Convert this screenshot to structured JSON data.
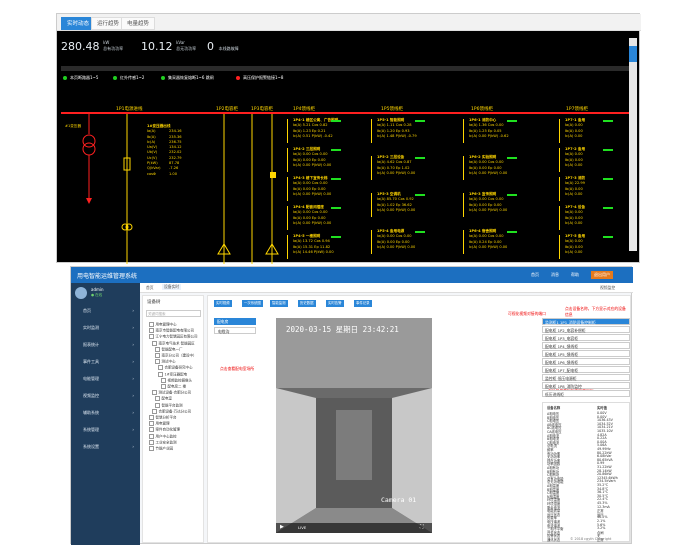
{
  "tabs": [
    "实时动态",
    "运行趋势",
    "电量趋势"
  ],
  "kpis": [
    {
      "value": "280.48",
      "unit": "kW",
      "label": "总有功功率"
    },
    {
      "value": "10.12",
      "unit": "kVar",
      "label": "总无功功率"
    },
    {
      "value": "0",
      "unit": "",
      "label": "本线路故障"
    }
  ],
  "legend": [
    {
      "text": "本页断路器1~5",
      "color": "#20d020"
    },
    {
      "text": "红外传感1~2",
      "color": "#20d020"
    },
    {
      "text": "集采器恢复熔断1~6 跳闸",
      "color": "#20d020"
    },
    {
      "text": "高压保护报警链接1~8",
      "color": "#ff2020"
    }
  ],
  "busbars": [
    "1P1电源进线",
    "1P2电容柜",
    "1P3电容柜",
    "1P4馈线柜",
    "1P5馈线柜",
    "1P6馈线柜",
    "1P7馈线柜"
  ],
  "transformer": "#1变压器",
  "incoming": {
    "title": "1#变压器出线",
    "rows": [
      [
        "Ia(A)",
        "234.16"
      ],
      [
        "Ib(A)",
        "235.36"
      ],
      [
        "Ic(A)",
        "236.75"
      ],
      [
        "Ua(V)",
        "134.12"
      ],
      [
        "Ub(V)",
        "232.02"
      ],
      [
        "Uc(V)",
        "232.79"
      ],
      [
        "P(kW)",
        "87.78"
      ],
      [
        "Q(kVar)",
        "-7.26"
      ],
      [
        "cosΦ",
        "1.00"
      ]
    ]
  },
  "feeders": [
    {
      "title": "1P4-1 楼区公寓、广告照明",
      "rows": [
        "Ia(A) 5.21 Cos 0.82",
        "Ib(A) 1.23 Ep 0.21",
        "Ic(A) 0.51 P(kW) -0.42"
      ]
    },
    {
      "title": "1P4-2 三层照明",
      "rows": [
        "Ia(A) 0.00 Cos 0.00",
        "Ib(A) 0.00 Ep 0.00",
        "Ic(A) 0.00 P(kW) 0.00"
      ]
    },
    {
      "title": "1P4-3 楼下宣传长梯",
      "rows": [
        "Ia(A) 0.00 Cos 0.00",
        "Ib(A) 0.00 Ep 0.00",
        "Ic(A) 0.00 P(kW) 0.00"
      ]
    },
    {
      "title": "1P4-4 配套间插座",
      "rows": [
        "Ia(A) 0.00 Cos 0.00",
        "Ib(A) 0.00 Ep 0.00",
        "Ic(A) 0.00 P(kW) 0.00"
      ]
    },
    {
      "title": "1P4-5 一楼照明",
      "rows": [
        "Ia(A) 13.72 Cos 0.94",
        "Ib(A) 15.31 Ep 11.82",
        "Ic(A) 14.46 P(kW) 0.00"
      ]
    },
    {
      "title": "1P5-1 智能照明",
      "rows": [
        "Ia(A) 1.11 Cos 0.28",
        "Ib(A) 1.20 Ep 0.93",
        "Ic(A) 1.48 P(kW) -0.79"
      ]
    },
    {
      "title": "1P5-2 三层设备",
      "rows": [
        "Ia(A) 4.62 Cos 0.87",
        "Ib(A) 0.70 Ep 1.02",
        "Ic(A) 0.00 P(kW) 0.00"
      ]
    },
    {
      "title": "1P5-3 空调机",
      "rows": [
        "Ia(A) 85.70 Cos 0.92",
        "Ib(A) 1.02 Ep 36.62",
        "Ic(A) 0.00 P(kW) 0.00"
      ]
    },
    {
      "title": "1P5-4 备用电源",
      "rows": [
        "Ia(A) 0.00 Cos 0.00",
        "Ib(A) 0.00 Ep 0.00",
        "Ic(A) 0.00 P(kW) 0.00"
      ]
    },
    {
      "title": "1P6-1 消防中心",
      "rows": [
        "Ia(A) 1.36 Cos 0.00",
        "Ib(A) 1.25 Ep 0.05",
        "Ic(A) 0.00 P(kW) -0.62"
      ]
    },
    {
      "title": "1P6-2 实验照明",
      "rows": [
        "Ia(A) 0.00 Cos 0.00",
        "Ib(A) 0.00 Ep 0.00",
        "Ic(A) 0.00 P(kW) 0.00"
      ]
    },
    {
      "title": "1P6-3 宣传照明",
      "rows": [
        "Ia(A) 0.00 Cos 0.00",
        "Ib(A) 0.00 Ep 0.00",
        "Ic(A) 0.00 P(kW) 0.00"
      ]
    },
    {
      "title": "1P6-4 宿舍照明",
      "rows": [
        "Ia(A) 0.00 Cos 0.00",
        "Ib(A) 0.24 Ep 0.00",
        "Ic(A) 0.00 P(kW) 0.00"
      ]
    },
    {
      "title": "1P7-1 备用",
      "rows": [
        "Ia(A) 0.00",
        "Ib(A) 0.00",
        "Ic(A) 0.00"
      ]
    },
    {
      "title": "1P7-2 备用",
      "rows": [
        "Ia(A) 0.00",
        "Ib(A) 0.00",
        "Ic(A) 0.00"
      ]
    },
    {
      "title": "1P7-3 消防",
      "rows": [
        "Ia(A) 22.99",
        "Ib(A) 0.00",
        "Ic(A) 0.00"
      ]
    },
    {
      "title": "1P7-4 设备",
      "rows": [
        "Ia(A) 0.00",
        "Ib(A) 0.00",
        "Ic(A) 0.00"
      ]
    },
    {
      "title": "1P7-5 备用",
      "rows": [
        "Ia(A) 0.00",
        "Ib(A) 0.00",
        "Ic(A) 0.00"
      ]
    }
  ],
  "app": {
    "title": "用电智能运维管理系统",
    "header_right": [
      "首页",
      "消息",
      "帮助",
      "退出用户"
    ],
    "user": "admin",
    "user_status": "● 在线",
    "menu": [
      "首页",
      "实时监测",
      "报表统计",
      "事件工具",
      "电能管理",
      "视频监控",
      "辅助系统",
      "系统管理",
      "系统设置"
    ],
    "crumbs": [
      "首页",
      "设备实时",
      "视频监控"
    ],
    "tree_title": "设备树",
    "tree_search": "关键词搜索",
    "tree": [
      "用电管理中心",
      "南京市智能配电有限公司",
      "江宁电力智慧园区有限公司",
      "南京电气技术 智能园区",
      "智能配电一厂",
      "南京分公司（建设中）",
      "测试中心",
      "合肥设备研究中心",
      "1#变压器配电",
      "视频监控摄像头",
      "配电房二 楼",
      "测试设备·合肥分公司",
      "配电室",
      "智能平台监测",
      "合肥设备·万达分公司",
      "智慧分析平台",
      "用电管理",
      "案件自动化管理",
      "用户中心监控",
      "工业安全监测",
      "节能产业园"
    ],
    "toolbar": [
      "实时视频",
      "一次系统图",
      "智能监测",
      "历史数据",
      "实时告警",
      "事件记录"
    ],
    "left_list": [
      "配电房",
      "电缆沟"
    ],
    "video_date": "2020-03-15  星期日  23:42:21",
    "video_cam": "Camera 01",
    "video_live": "LIVE",
    "notes": [
      "可视化视频对接的端口",
      "点击查看配电室场所",
      "点击设备名称，下方显示对应的设备信息",
      "对应设备实时的电参量信息"
    ],
    "cams": [
      "监测柜1 1P1_消防设备控制柜",
      "配电柜 1P2_电容补偿柜",
      "配电柜 1P3_电容柜",
      "配电柜 1P4_馈线柜",
      "配电柜 1P5_馈线柜",
      "配电柜 1P6_馈线柜",
      "配电柜 1P7_配电柜",
      "监控柜 低压电源柜",
      "配电柜 1P8_消防监控",
      "低压进线柜"
    ],
    "param_hdr": [
      "设备名称",
      "实时值"
    ],
    "params": [
      [
        "A相电压",
        "0.00V"
      ],
      [
        "B相电压",
        "0.00V"
      ],
      [
        "C相电压",
        "1036.43V"
      ],
      [
        "AB线电压",
        "1034.52V"
      ],
      [
        "BC线电压",
        "1034.21V"
      ],
      [
        "CA线电压",
        "1035.10V"
      ],
      [
        "A相电流",
        "4.82A"
      ],
      [
        "B相电流",
        "0.22A"
      ],
      [
        "C相电流",
        "0.00A"
      ],
      [
        "总电流",
        "5.06A"
      ],
      [
        "频率",
        "49.99Hz"
      ],
      [
        "有功功率",
        "80.22kW"
      ],
      [
        "无功功率",
        "6.08kVar"
      ],
      [
        "视在功率",
        "80.65kVA"
      ],
      [
        "功率因数",
        "0.99"
      ],
      [
        "A相有功",
        "31.22kW"
      ],
      [
        "B相有功",
        "28.14kW"
      ],
      [
        "C相有功",
        "20.86kW"
      ],
      [
        "总有功电能",
        "12345.6kWh"
      ],
      [
        "总无功电能",
        "234.5kVarh"
      ],
      [
        "A相温度",
        "35.2℃"
      ],
      [
        "B相温度",
        "34.8℃"
      ],
      [
        "C相温度",
        "36.1℃"
      ],
      [
        "N相温度",
        "30.5℃"
      ],
      [
        "环境温度",
        "22.4℃"
      ],
      [
        "环境湿度",
        "45.3%"
      ],
      [
        "剩余电流",
        "12.3mA"
      ],
      [
        "电能质量",
        "正常"
      ],
      [
        "运行状态",
        "运行"
      ],
      [
        "负载率",
        "40.2%"
      ],
      [
        "电压谐波",
        "2.1%"
      ],
      [
        "电流谐波",
        "5.6%"
      ],
      [
        "三相不平衡",
        "3.2%"
      ],
      [
        "开关状态",
        "合闸"
      ],
      [
        "告警状态",
        "无"
      ],
      [
        "通讯状态",
        "正常"
      ]
    ],
    "copyright": "© 2018 cgyth Copyright"
  }
}
